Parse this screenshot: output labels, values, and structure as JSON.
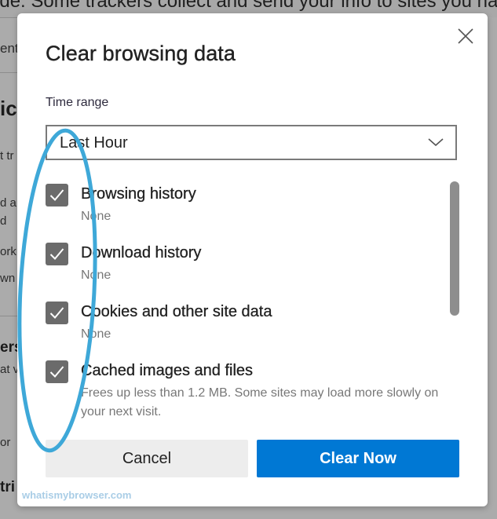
{
  "background": {
    "top_text": "ade. Some trackers collect and send your info to sites you haven't v",
    "left_fragments": [
      "ent",
      "ic",
      "t tr",
      "d a",
      "d",
      "ork",
      "wn",
      "ers",
      "at v",
      "or",
      "tri"
    ]
  },
  "dialog": {
    "title": "Clear browsing data",
    "close_icon": "close-icon",
    "time_range": {
      "label": "Time range",
      "selected": "Last Hour",
      "icon": "chevron-down-icon"
    },
    "items": [
      {
        "label": "Browsing history",
        "detail": "None",
        "checked": true
      },
      {
        "label": "Download history",
        "detail": "None",
        "checked": true
      },
      {
        "label": "Cookies and other site data",
        "detail": "None",
        "checked": true
      },
      {
        "label": "Cached images and files",
        "detail": "Frees up less than 1.2 MB. Some sites may load more slowly on your next visit.",
        "checked": true
      }
    ],
    "buttons": {
      "cancel": "Cancel",
      "clear": "Clear Now"
    },
    "colors": {
      "primary": "#0078d4",
      "checkbox": "#6b6b6b",
      "annotation": "#3ea8d8"
    }
  },
  "watermark": "whatismybrowser.com"
}
